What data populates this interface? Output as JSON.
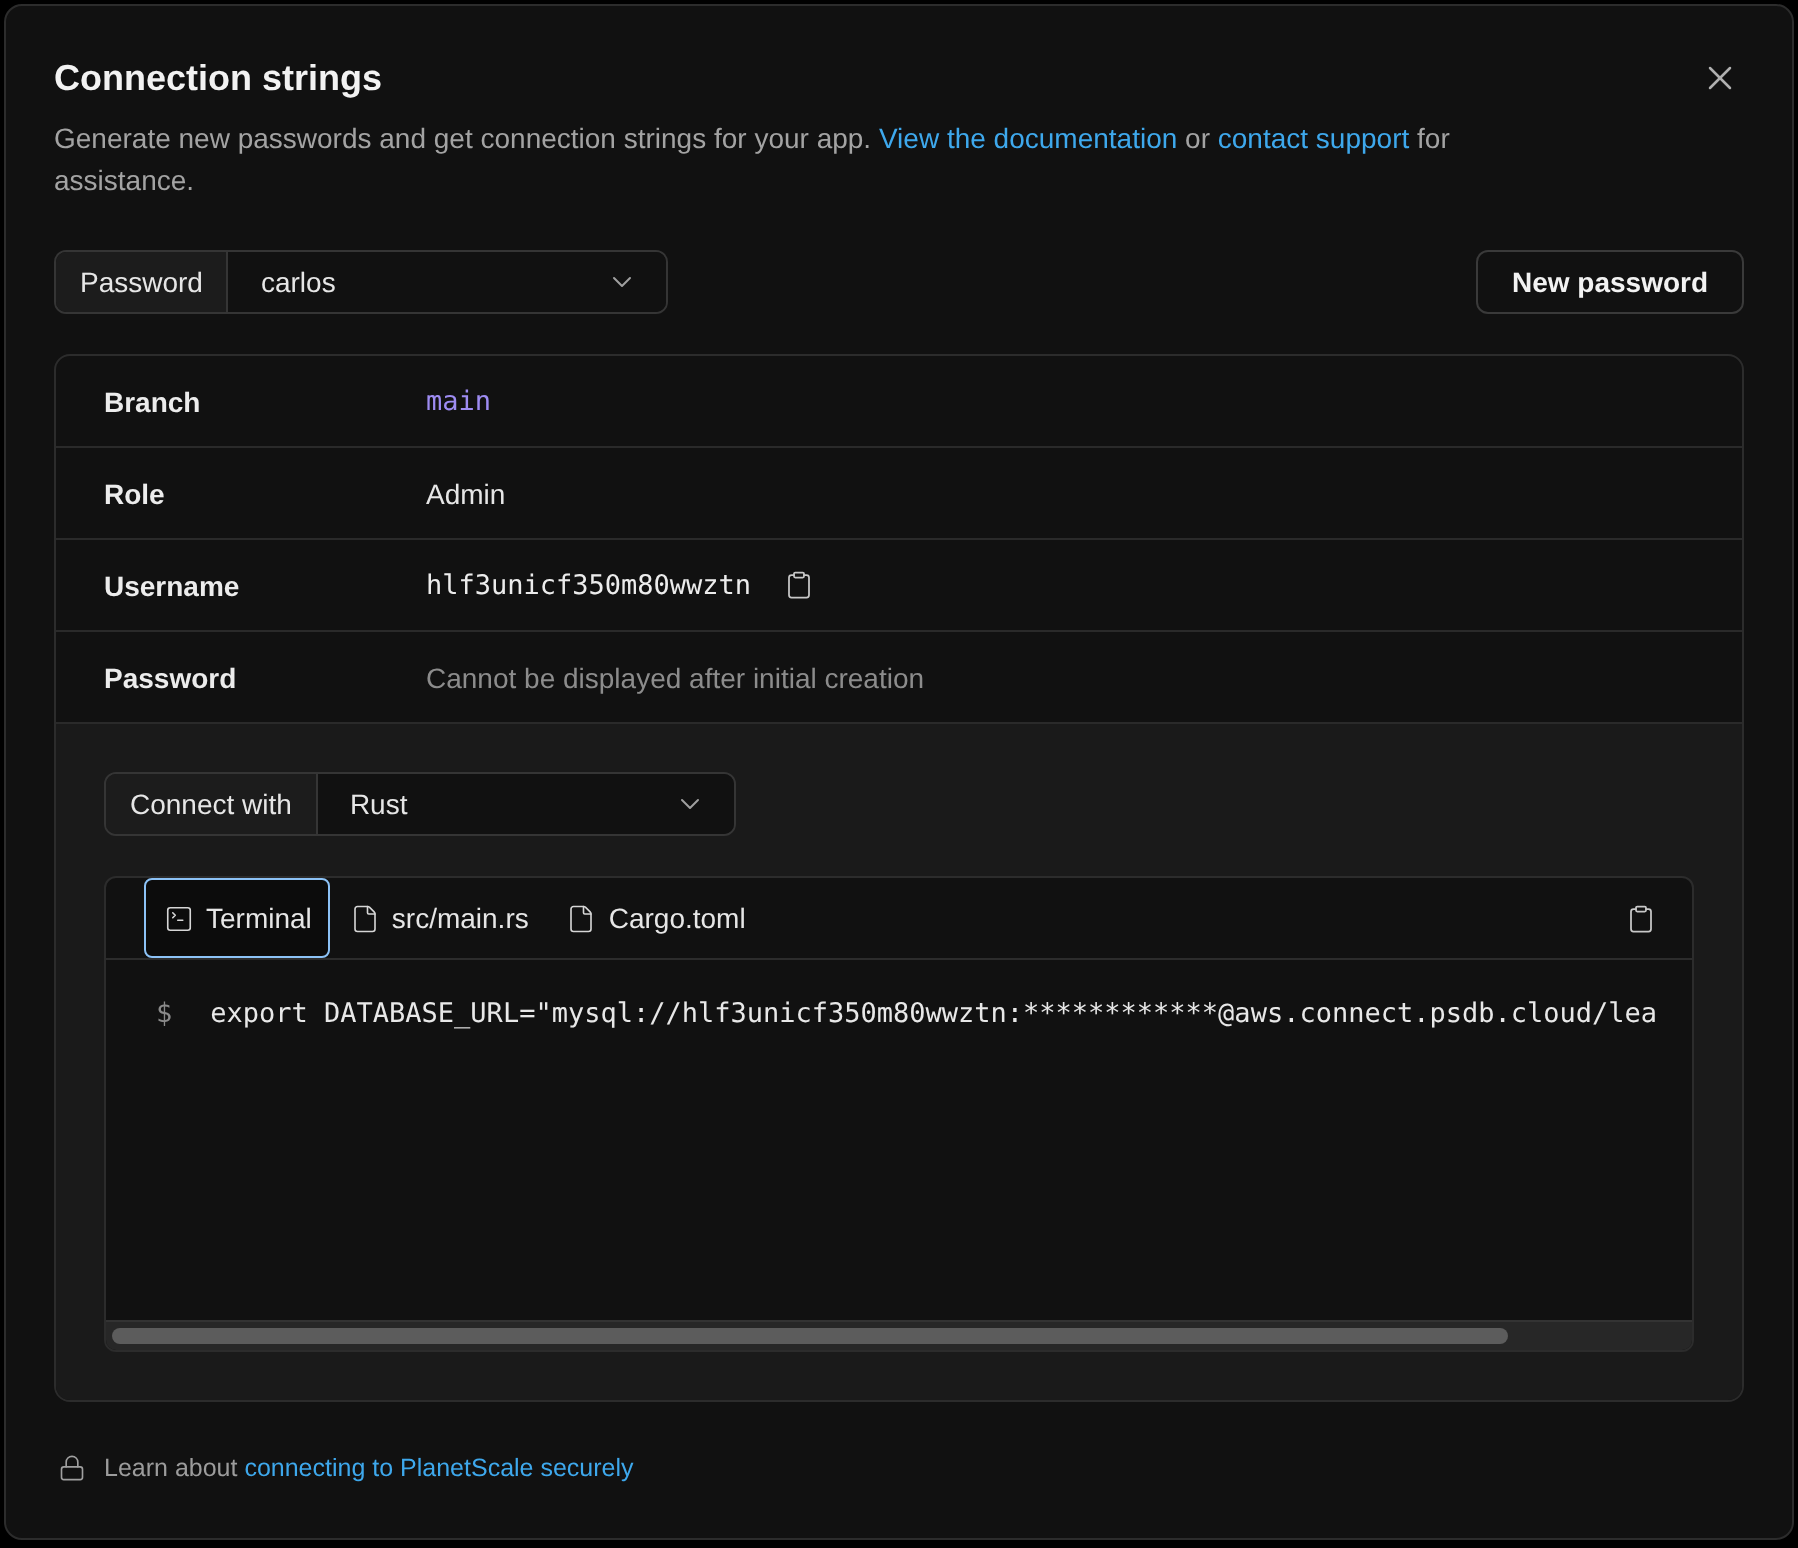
{
  "dialog": {
    "title": "Connection strings"
  },
  "description": [
    {
      "kind": "text",
      "text": "Generate new passwords and get connection strings for your app. "
    },
    {
      "kind": "link",
      "text": "View the documentation"
    },
    {
      "kind": "text",
      "text": " or "
    },
    {
      "kind": "link",
      "text": "contact support"
    },
    {
      "kind": "text",
      "text": " for assistance."
    }
  ],
  "password_select": {
    "label": "Password",
    "value": "carlos"
  },
  "new_password_button": {
    "label": "New password"
  },
  "details": [
    {
      "label": "Branch",
      "value": "main",
      "kind": "branch"
    },
    {
      "label": "Role",
      "value": "Admin",
      "kind": "plain"
    },
    {
      "label": "Username",
      "value": "hlf3unicf350m80wwztn",
      "kind": "copyable"
    },
    {
      "label": "Password",
      "value": "Cannot be displayed after initial creation",
      "kind": "muted"
    }
  ],
  "connect_select": {
    "label": "Connect with",
    "value": "Rust"
  },
  "code_tabs": [
    {
      "label": "Terminal",
      "kind": "terminal",
      "selected": true
    },
    {
      "label": "src/main.rs",
      "kind": "file",
      "selected": false
    },
    {
      "label": "Cargo.toml",
      "kind": "file",
      "selected": false
    }
  ],
  "code": {
    "prompt": "$",
    "line": "export DATABASE_URL=\"mysql://hlf3unicf350m80wwztn:************@aws.connect.psdb.cloud/lea"
  },
  "footer": [
    {
      "kind": "text",
      "text": "Learn about "
    },
    {
      "kind": "link",
      "text": "connecting to PlanetScale securely"
    }
  ]
}
